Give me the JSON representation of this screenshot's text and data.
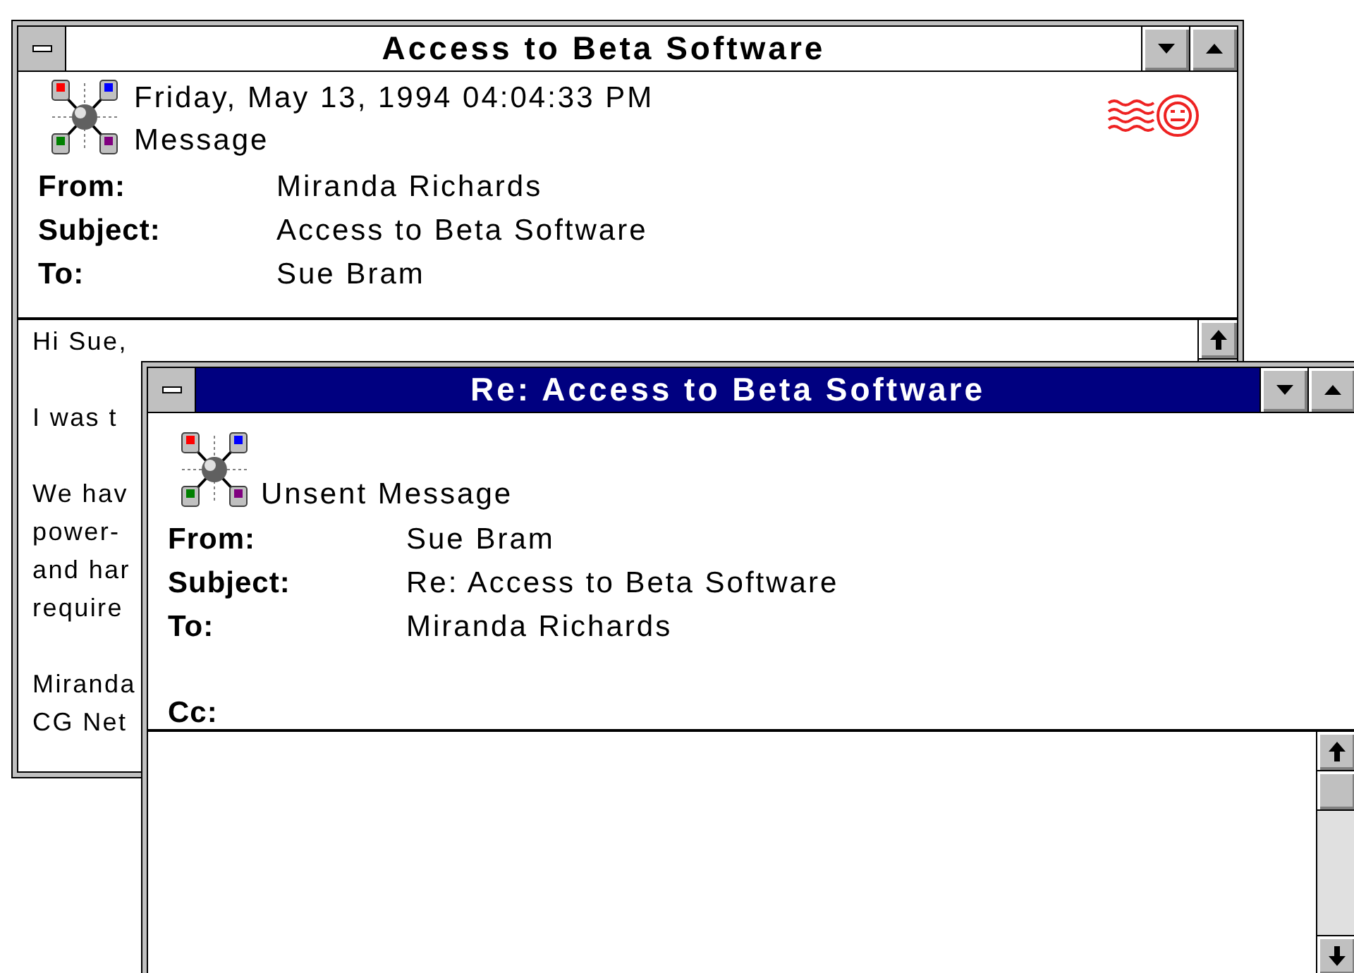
{
  "windows": [
    {
      "title": "Access to Beta Software",
      "active": false,
      "timestamp": "Friday, May 13, 1994 04:04:33 PM",
      "status": "Message",
      "postmarked": true,
      "fields": [
        {
          "label": "From:",
          "value": "Miranda Richards"
        },
        {
          "label": "Subject:",
          "value": "Access to Beta Software"
        },
        {
          "label": "To:",
          "value": "Sue Bram"
        }
      ],
      "body": [
        [
          "Hi Sue,"
        ],
        [
          "I was t"
        ],
        [
          "We hav",
          "power-",
          "and har",
          "require"
        ],
        [
          "Miranda",
          "CG Net"
        ]
      ]
    },
    {
      "title": "Re: Access to Beta Software",
      "active": true,
      "status": "Unsent Message",
      "fields": [
        {
          "label": "From:",
          "value": "Sue Bram"
        },
        {
          "label": "Subject:",
          "value": "Re: Access to Beta Software"
        },
        {
          "label": "To:",
          "value": "Miranda Richards"
        },
        {
          "label": "Cc:",
          "gap": true
        }
      ]
    }
  ]
}
